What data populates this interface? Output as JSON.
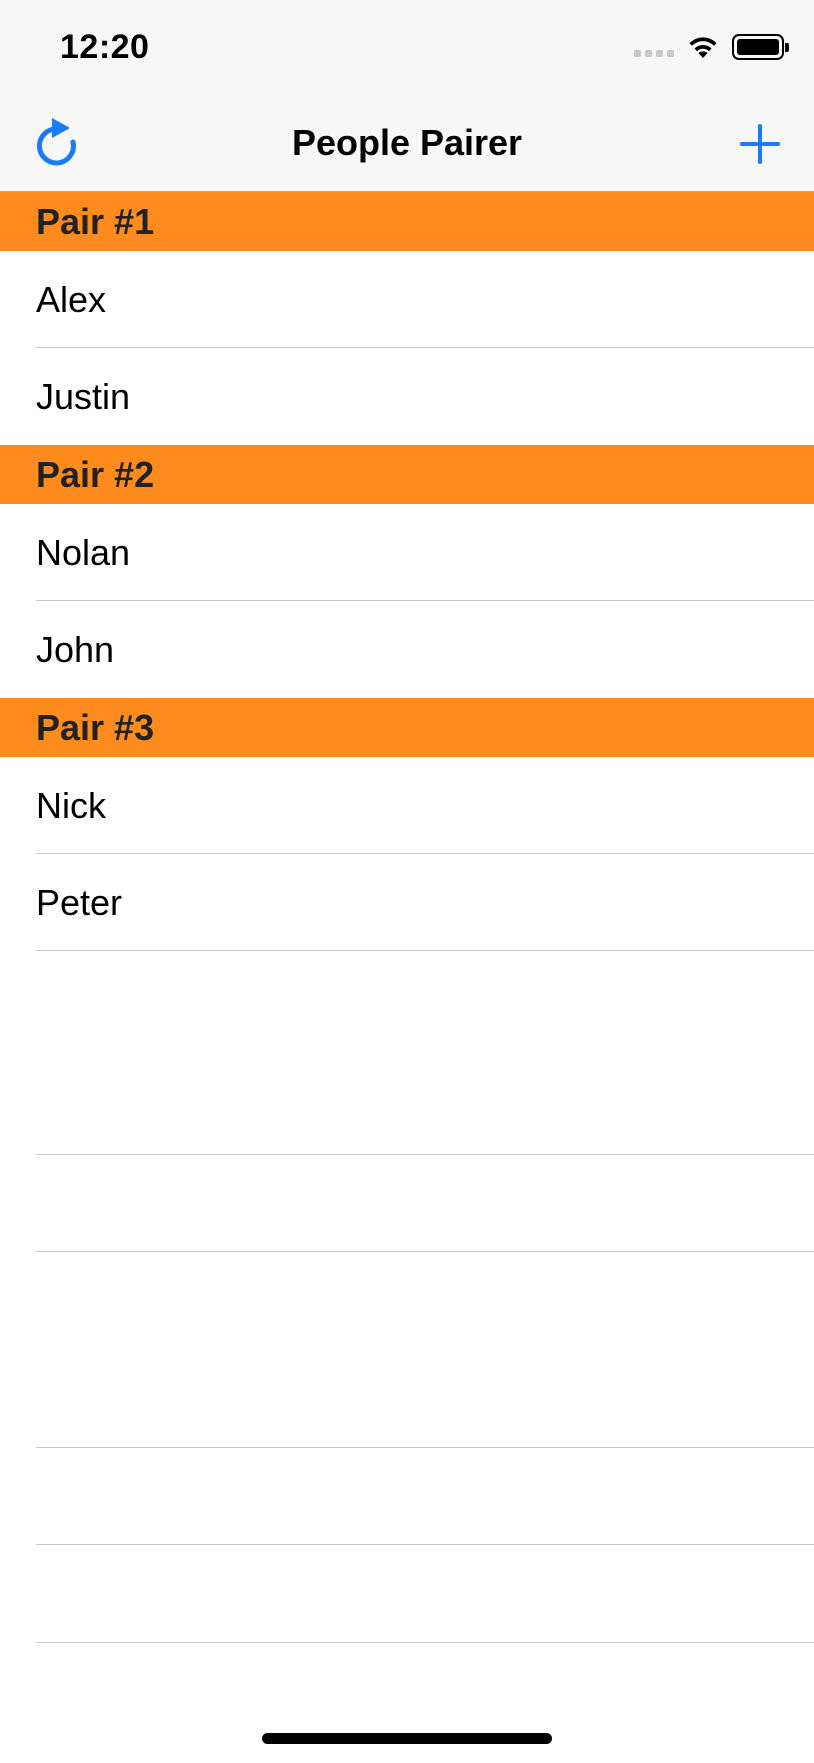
{
  "status_bar": {
    "time": "12:20",
    "icons": [
      "signal-icon",
      "wifi-icon",
      "battery-icon"
    ]
  },
  "nav": {
    "title": "People Pairer",
    "left_icon": "refresh-icon",
    "right_icon": "plus-icon",
    "accent_color": "#1a7cf5"
  },
  "sections": [
    {
      "header": "Pair #1",
      "people": [
        "Alex",
        "Justin"
      ]
    },
    {
      "header": "Pair #2",
      "people": [
        "Nolan",
        "John"
      ]
    },
    {
      "header": "Pair #3",
      "people": [
        "Nick",
        "Peter"
      ]
    }
  ],
  "colors": {
    "section_header_bg": "#fd8b1e",
    "separator": "#c8c7cc",
    "bar_bg": "#f7f7f7"
  }
}
